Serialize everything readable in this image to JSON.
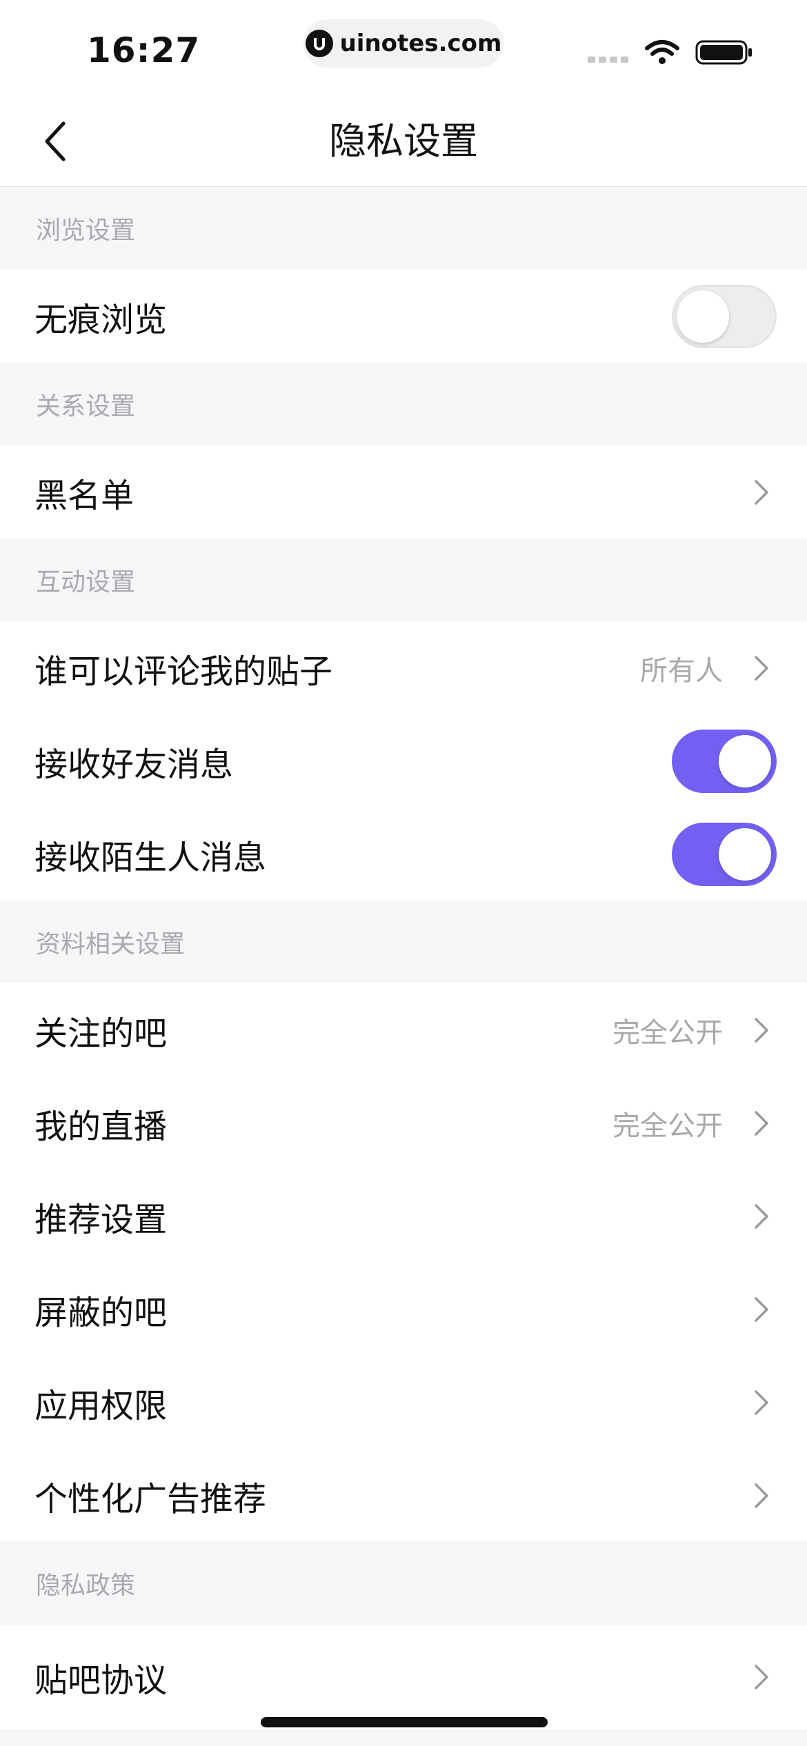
{
  "status_bar": {
    "time": "16:27",
    "url": "uinotes.com"
  },
  "nav": {
    "title": "隐私设置"
  },
  "sections": {
    "browse": {
      "header": "浏览设置",
      "incognito": {
        "label": "无痕浏览",
        "enabled": false
      }
    },
    "relation": {
      "header": "关系设置",
      "blacklist": {
        "label": "黑名单"
      }
    },
    "interaction": {
      "header": "互动设置",
      "comment": {
        "label": "谁可以评论我的贴子",
        "value": "所有人"
      },
      "friend_msg": {
        "label": "接收好友消息",
        "enabled": true
      },
      "stranger_msg": {
        "label": "接收陌生人消息",
        "enabled": true
      }
    },
    "profile": {
      "header": "资料相关设置",
      "followed_bars": {
        "label": "关注的吧",
        "value": "完全公开"
      },
      "my_live": {
        "label": "我的直播",
        "value": "完全公开"
      },
      "recommend": {
        "label": "推荐设置"
      },
      "blocked_bars": {
        "label": "屏蔽的吧"
      },
      "app_permissions": {
        "label": "应用权限"
      },
      "personalized_ads": {
        "label": "个性化广告推荐"
      }
    },
    "policy": {
      "header": "隐私政策",
      "agreement": {
        "label": "贴吧协议"
      }
    }
  },
  "colors": {
    "accent": "#7360f2",
    "section_bg": "#f6f6f8",
    "secondary_text": "#a8a8ac"
  }
}
